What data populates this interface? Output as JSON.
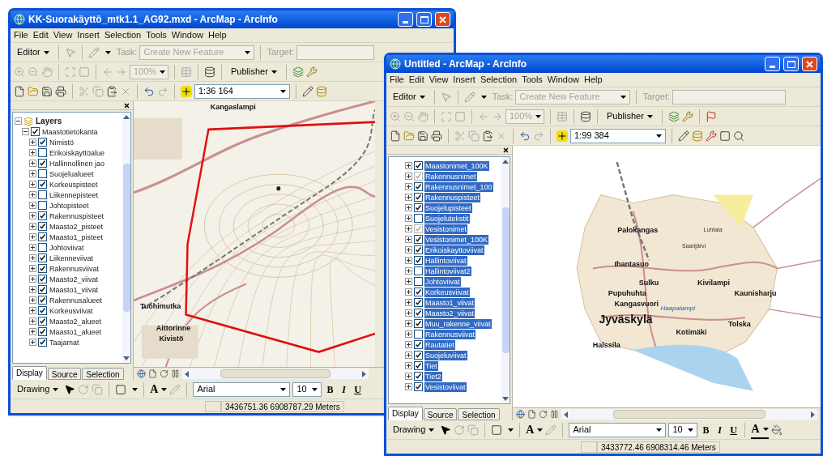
{
  "windows": [
    {
      "title": "KK-Suorakäyttö_mtk1.1_AG92.mxd - ArcMap - ArcInfo",
      "menu": [
        "File",
        "Edit",
        "View",
        "Insert",
        "Selection",
        "Tools",
        "Window",
        "Help"
      ],
      "editor": {
        "label": "Editor",
        "task_label": "Task:",
        "task_value": "Create New Feature",
        "task_disabled": true,
        "target_label": "Target:"
      },
      "zoom": {
        "value": "100%",
        "disabled": true
      },
      "publisher": "Publisher",
      "scale": "1:36 164",
      "toc": {
        "items": [
          {
            "kind": "data_frame",
            "label": "Layers",
            "expanded": true,
            "children": [
              {
                "kind": "layer",
                "label": "Maastotietokanta",
                "checked": true,
                "expanded": true,
                "children": [
                  {
                    "kind": "layer",
                    "label": "Nimistö",
                    "checked": true,
                    "expanded": false
                  },
                  {
                    "kind": "layer",
                    "label": "Erikoiskäyttöalue",
                    "checked": false,
                    "expanded": false
                  },
                  {
                    "kind": "layer",
                    "label": "Hallinnollinen jao",
                    "checked": true,
                    "expanded": false
                  },
                  {
                    "kind": "layer",
                    "label": "Suojelualueet",
                    "checked": false,
                    "expanded": false
                  },
                  {
                    "kind": "layer",
                    "label": "Korkeuspisteet",
                    "checked": true,
                    "expanded": false
                  },
                  {
                    "kind": "layer",
                    "label": "Liikennepisteet",
                    "checked": false,
                    "expanded": false
                  },
                  {
                    "kind": "layer",
                    "label": "Johtopisteet",
                    "checked": false,
                    "expanded": false
                  },
                  {
                    "kind": "layer",
                    "label": "Rakennuspisteet",
                    "checked": true,
                    "expanded": false
                  },
                  {
                    "kind": "layer",
                    "label": "Maasto2_pisteet",
                    "checked": true,
                    "expanded": false
                  },
                  {
                    "kind": "layer",
                    "label": "Maasto1_pisteet",
                    "checked": true,
                    "expanded": false
                  },
                  {
                    "kind": "layer",
                    "label": "Johtoviivat",
                    "checked": false,
                    "expanded": false
                  },
                  {
                    "kind": "layer",
                    "label": "Liikenneviivat",
                    "checked": true,
                    "expanded": false
                  },
                  {
                    "kind": "layer",
                    "label": "Rakennusviivat",
                    "checked": true,
                    "expanded": false
                  },
                  {
                    "kind": "layer",
                    "label": "Maasto2_viivat",
                    "checked": true,
                    "expanded": false
                  },
                  {
                    "kind": "layer",
                    "label": "Maasto1_viivat",
                    "checked": true,
                    "expanded": false
                  },
                  {
                    "kind": "layer",
                    "label": "Rakennusalueet",
                    "checked": true,
                    "expanded": false
                  },
                  {
                    "kind": "layer",
                    "label": "Korkeusviivat",
                    "checked": true,
                    "expanded": false
                  },
                  {
                    "kind": "layer",
                    "label": "Maasto2_alueet",
                    "checked": true,
                    "expanded": false
                  },
                  {
                    "kind": "layer",
                    "label": "Maasto1_alueet",
                    "checked": true,
                    "expanded": false
                  },
                  {
                    "kind": "layer",
                    "label": "Taajamat",
                    "checked": true,
                    "expanded": false
                  }
                ]
              }
            ]
          }
        ]
      },
      "tabs": [
        {
          "label": "Display",
          "selected": true
        },
        {
          "label": "Source",
          "selected": false
        },
        {
          "label": "Selection",
          "selected": false
        }
      ],
      "map_labels": [
        {
          "text": "Kangaslampi",
          "kind": "place"
        },
        {
          "text": "Tuohimutka",
          "kind": "place"
        },
        {
          "text": "Aittorinne",
          "kind": "place"
        },
        {
          "text": "Kivistö",
          "kind": "place"
        }
      ],
      "drawing": {
        "label": "Drawing",
        "text_tool": "A",
        "font": "Arial",
        "size": "10",
        "format_buttons": [
          "B",
          "I",
          "U"
        ]
      },
      "status": "3436751.36 6908787.29 Meters"
    },
    {
      "title": "Untitled - ArcMap - ArcInfo",
      "menu": [
        "File",
        "Edit",
        "View",
        "Insert",
        "Selection",
        "Tools",
        "Window",
        "Help"
      ],
      "editor": {
        "label": "Editor",
        "task_label": "Task:",
        "task_value": "Create New Feature",
        "task_disabled": true,
        "target_label": "Target:"
      },
      "zoom": {
        "value": "100%",
        "disabled": true
      },
      "publisher": "Publisher",
      "scale": "1:99 384",
      "toc": {
        "items": [
          {
            "kind": "layer",
            "label": "Maastonimet_100K",
            "checked": true,
            "selected": true,
            "expanded": false
          },
          {
            "kind": "layer",
            "label": "Rakennusnimet",
            "checked": true,
            "greyed": true,
            "selected": true,
            "expanded": false
          },
          {
            "kind": "layer",
            "label": "Rakennusnimet_100",
            "checked": true,
            "selected": true,
            "expanded": false
          },
          {
            "kind": "layer",
            "label": "Rakennuspisteet",
            "checked": true,
            "selected": true,
            "expanded": false
          },
          {
            "kind": "layer",
            "label": "Suojelupisteet",
            "checked": true,
            "selected": true,
            "expanded": false
          },
          {
            "kind": "layer",
            "label": "Suojelutekstit",
            "checked": false,
            "selected": true,
            "expanded": false
          },
          {
            "kind": "layer",
            "label": "Vesistonimet",
            "checked": true,
            "greyed": true,
            "selected": true,
            "expanded": false
          },
          {
            "kind": "layer",
            "label": "Vesistonimet_100K",
            "checked": true,
            "selected": true,
            "expanded": false
          },
          {
            "kind": "layer",
            "label": "Erikoiskayttoviivat",
            "checked": true,
            "selected": true,
            "expanded": false
          },
          {
            "kind": "layer",
            "label": "Hallintoviivat",
            "checked": true,
            "selected": true,
            "expanded": false
          },
          {
            "kind": "layer",
            "label": "Hallintoviivat2",
            "checked": false,
            "selected": true,
            "expanded": false
          },
          {
            "kind": "layer",
            "label": "Johtoviivat",
            "checked": false,
            "selected": true,
            "expanded": false
          },
          {
            "kind": "layer",
            "label": "Korkeusviivat",
            "checked": true,
            "selected": true,
            "expanded": false
          },
          {
            "kind": "layer",
            "label": "Maasto1_viivat",
            "checked": true,
            "selected": true,
            "expanded": false
          },
          {
            "kind": "layer",
            "label": "Maasto2_viivat",
            "checked": true,
            "selected": true,
            "expanded": false
          },
          {
            "kind": "layer",
            "label": "Muu_rakenne_viivat",
            "checked": true,
            "selected": true,
            "expanded": false
          },
          {
            "kind": "layer",
            "label": "Rakennusviivat",
            "checked": false,
            "selected": true,
            "expanded": false
          },
          {
            "kind": "layer",
            "label": "Rautatiet",
            "checked": true,
            "selected": true,
            "expanded": false
          },
          {
            "kind": "layer",
            "label": "Suojeluviivat",
            "checked": true,
            "selected": true,
            "expanded": false
          },
          {
            "kind": "layer",
            "label": "Tiet",
            "checked": true,
            "selected": true,
            "expanded": false
          },
          {
            "kind": "layer",
            "label": "Tiet2",
            "checked": true,
            "selected": true,
            "expanded": false
          },
          {
            "kind": "layer",
            "label": "Vesistoviivat",
            "checked": true,
            "selected": true,
            "expanded": false
          }
        ]
      },
      "tabs": [
        {
          "label": "Display",
          "selected": true
        },
        {
          "label": "Source",
          "selected": false
        },
        {
          "label": "Selection",
          "selected": false
        }
      ],
      "map_labels": [
        {
          "text": "Palokangas",
          "kind": "place"
        },
        {
          "text": "Luhtala",
          "kind": "small"
        },
        {
          "text": "Saarijärvi",
          "kind": "small"
        },
        {
          "text": "Ihantasuo",
          "kind": "place"
        },
        {
          "text": "Sulku",
          "kind": "place"
        },
        {
          "text": "Kivilampi",
          "kind": "place"
        },
        {
          "text": "Kaunisharju",
          "kind": "place"
        },
        {
          "text": "Pupuhuhta",
          "kind": "place"
        },
        {
          "text": "Kangasvuori",
          "kind": "place"
        },
        {
          "text": "Haapalampi",
          "kind": "water"
        },
        {
          "text": "Jyväskylä",
          "kind": "city"
        },
        {
          "text": "Tolska",
          "kind": "place"
        },
        {
          "text": "Kotimäki",
          "kind": "place"
        },
        {
          "text": "Halssila",
          "kind": "place"
        }
      ],
      "drawing": {
        "label": "Drawing",
        "text_tool": "A",
        "font": "Arial",
        "size": "10",
        "format_buttons": [
          "B",
          "I",
          "U"
        ],
        "font_color": "A"
      },
      "status": "3433772.46 6908314.46 Meters"
    }
  ]
}
